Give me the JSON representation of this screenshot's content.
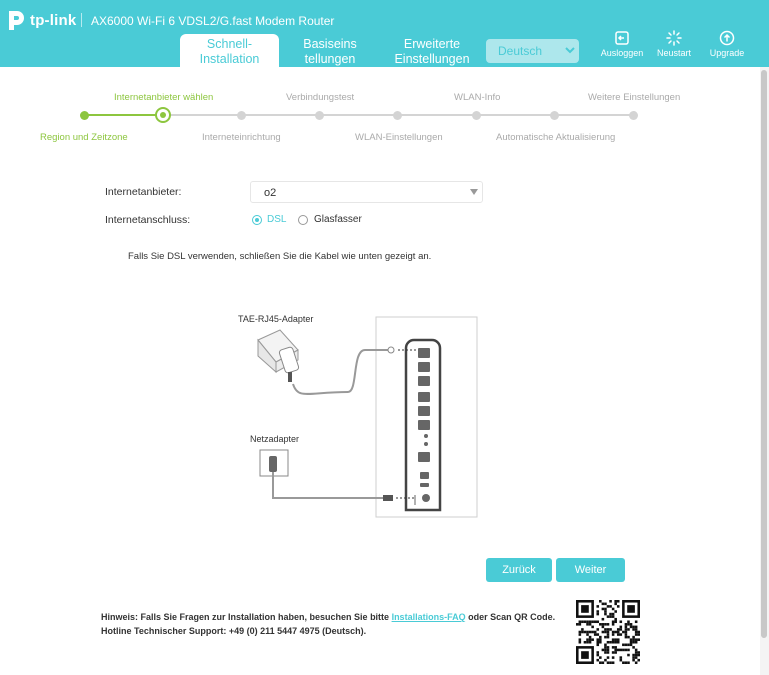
{
  "header": {
    "brand": "tp-link",
    "model": "AX6000 Wi-Fi 6 VDSL2/G.fast Modem Router",
    "tabs": [
      {
        "line1": "Schnell-",
        "line2": "Installation"
      },
      {
        "line1": "Basiseins",
        "line2": "tellungen"
      },
      {
        "line1": "Erweiterte",
        "line2": "Einstellungen"
      }
    ],
    "language": "Deutsch",
    "logout_label": "Ausloggen",
    "reboot_label": "Neustart",
    "upgrade_label": "Upgrade"
  },
  "stepper": {
    "top_labels": [
      "Internetanbieter wählen",
      "Verbindungstest",
      "WLAN-Info",
      "Weitere Einstellungen"
    ],
    "bottom_labels": [
      "Region und Zeitzone",
      "Interneteinrichtung",
      "WLAN-Einstellungen",
      "Automatische Aktualisierung"
    ],
    "completed_steps": 2,
    "total_steps": 8
  },
  "form": {
    "provider_label": "Internetanbieter:",
    "provider_value": "o2",
    "connection_label": "Internetanschluss:",
    "options": [
      "DSL",
      "Glasfasser"
    ],
    "selected": "DSL",
    "hint": "Falls Sie DSL verwenden, schließen Sie die Kabel wie unten gezeigt an."
  },
  "diagram": {
    "adapter_label": "TAE-RJ45-Adapter",
    "power_label": "Netzadapter"
  },
  "buttons": {
    "back": "Zurück",
    "next": "Weiter"
  },
  "footer": {
    "line1_prefix": "Hinweis: Falls Sie Fragen zur Installation haben, besuchen Sie bitte ",
    "line1_link": "Installations-FAQ",
    "line1_suffix": " oder Scan QR Code.",
    "line2": "Hotline Technischer Support: +49 (0) 211 5447 4975 (Deutsch)."
  },
  "colors": {
    "accent": "#4acbd6",
    "step_done": "#8dc63f",
    "step_pending": "#d4d4d4"
  }
}
